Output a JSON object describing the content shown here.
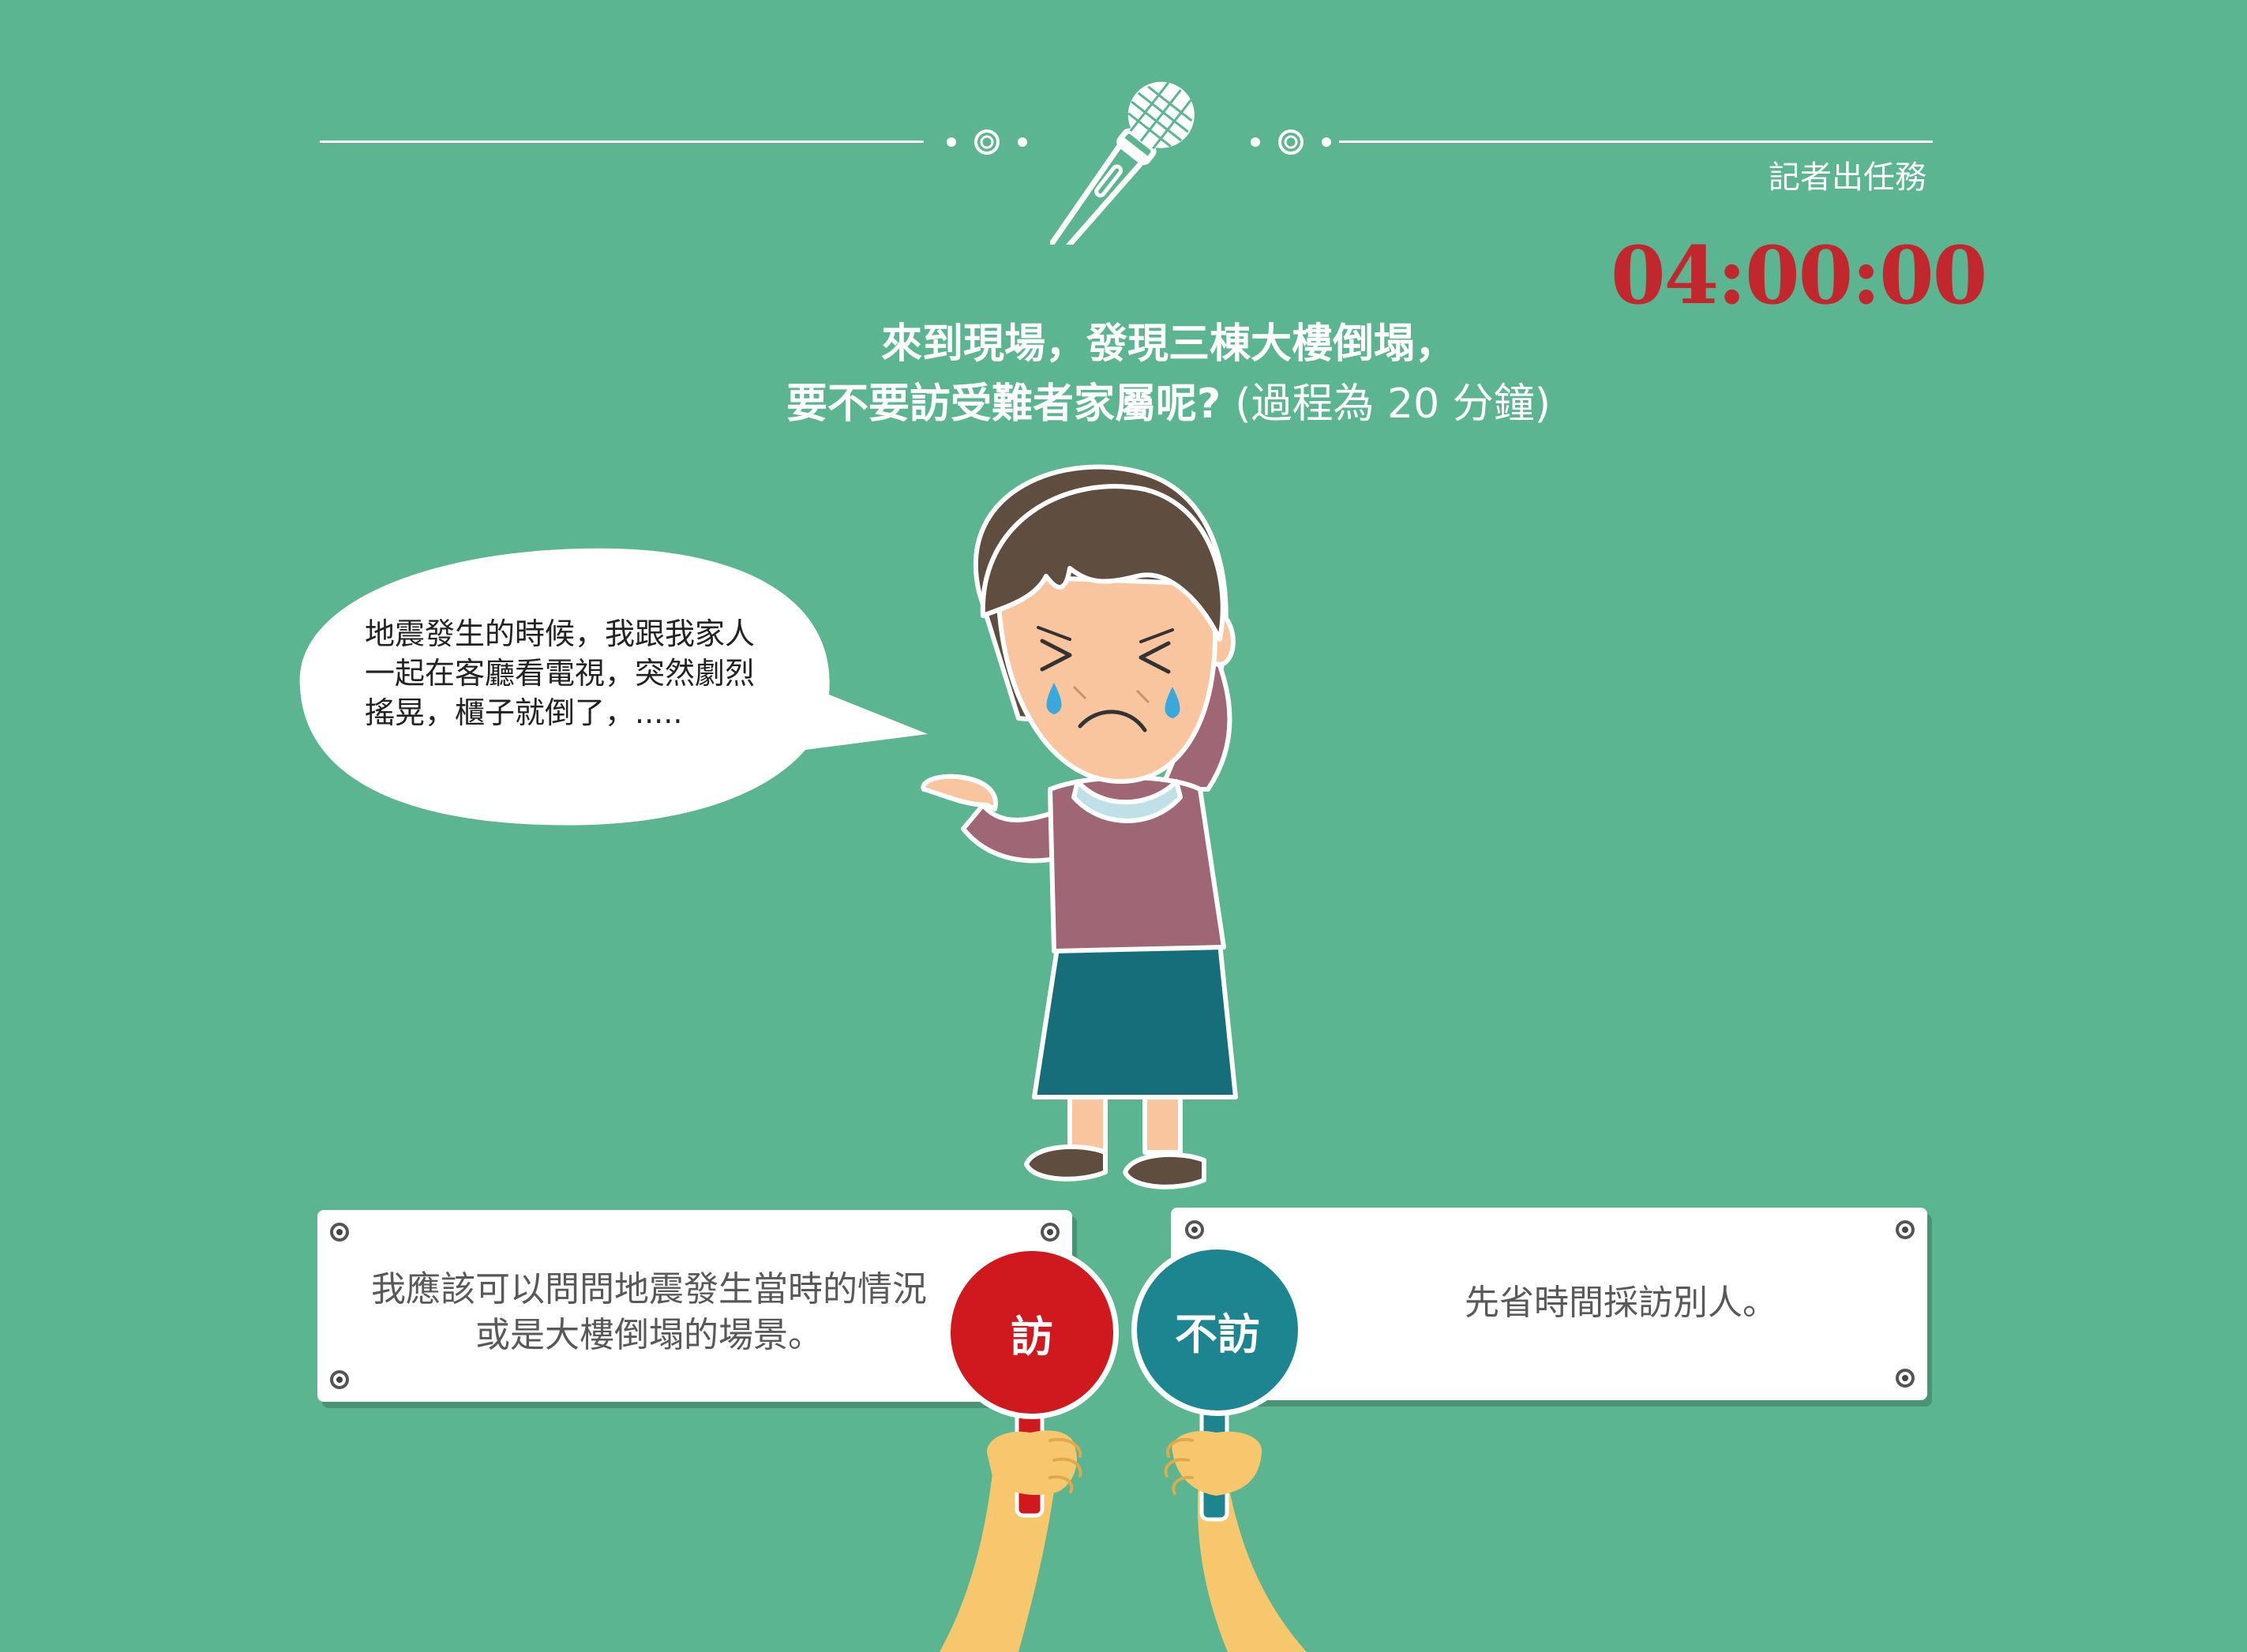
{
  "header": {
    "mission_label": "記者出任務",
    "timer": "04:00:00"
  },
  "question": {
    "line1": "來到現場，發現三棟大樓倒塌，",
    "line2": "要不要訪受難者家屬呢?",
    "note": "(過程為 20 分鐘)"
  },
  "speech": {
    "line1": "地震發生的時候，我跟我家人",
    "line2": "一起在客廳看電視，突然劇烈",
    "line3": "搖晃，櫃子就倒了，....."
  },
  "options": {
    "interview": {
      "text_line1": "我應該可以問問地震發生當時的情況",
      "text_line2": "或是大樓倒塌的場景。",
      "paddle_label": "訪",
      "color": "#d0191e"
    },
    "skip": {
      "text": "先省時間採訪別人。",
      "paddle_label": "不訪",
      "color": "#1c8590"
    }
  },
  "icons": [
    "microphone-icon",
    "ornament-icon",
    "crying-woman-illustration",
    "hand-icon"
  ],
  "colors": {
    "background": "#5bb590",
    "timer": "#c1272d"
  }
}
